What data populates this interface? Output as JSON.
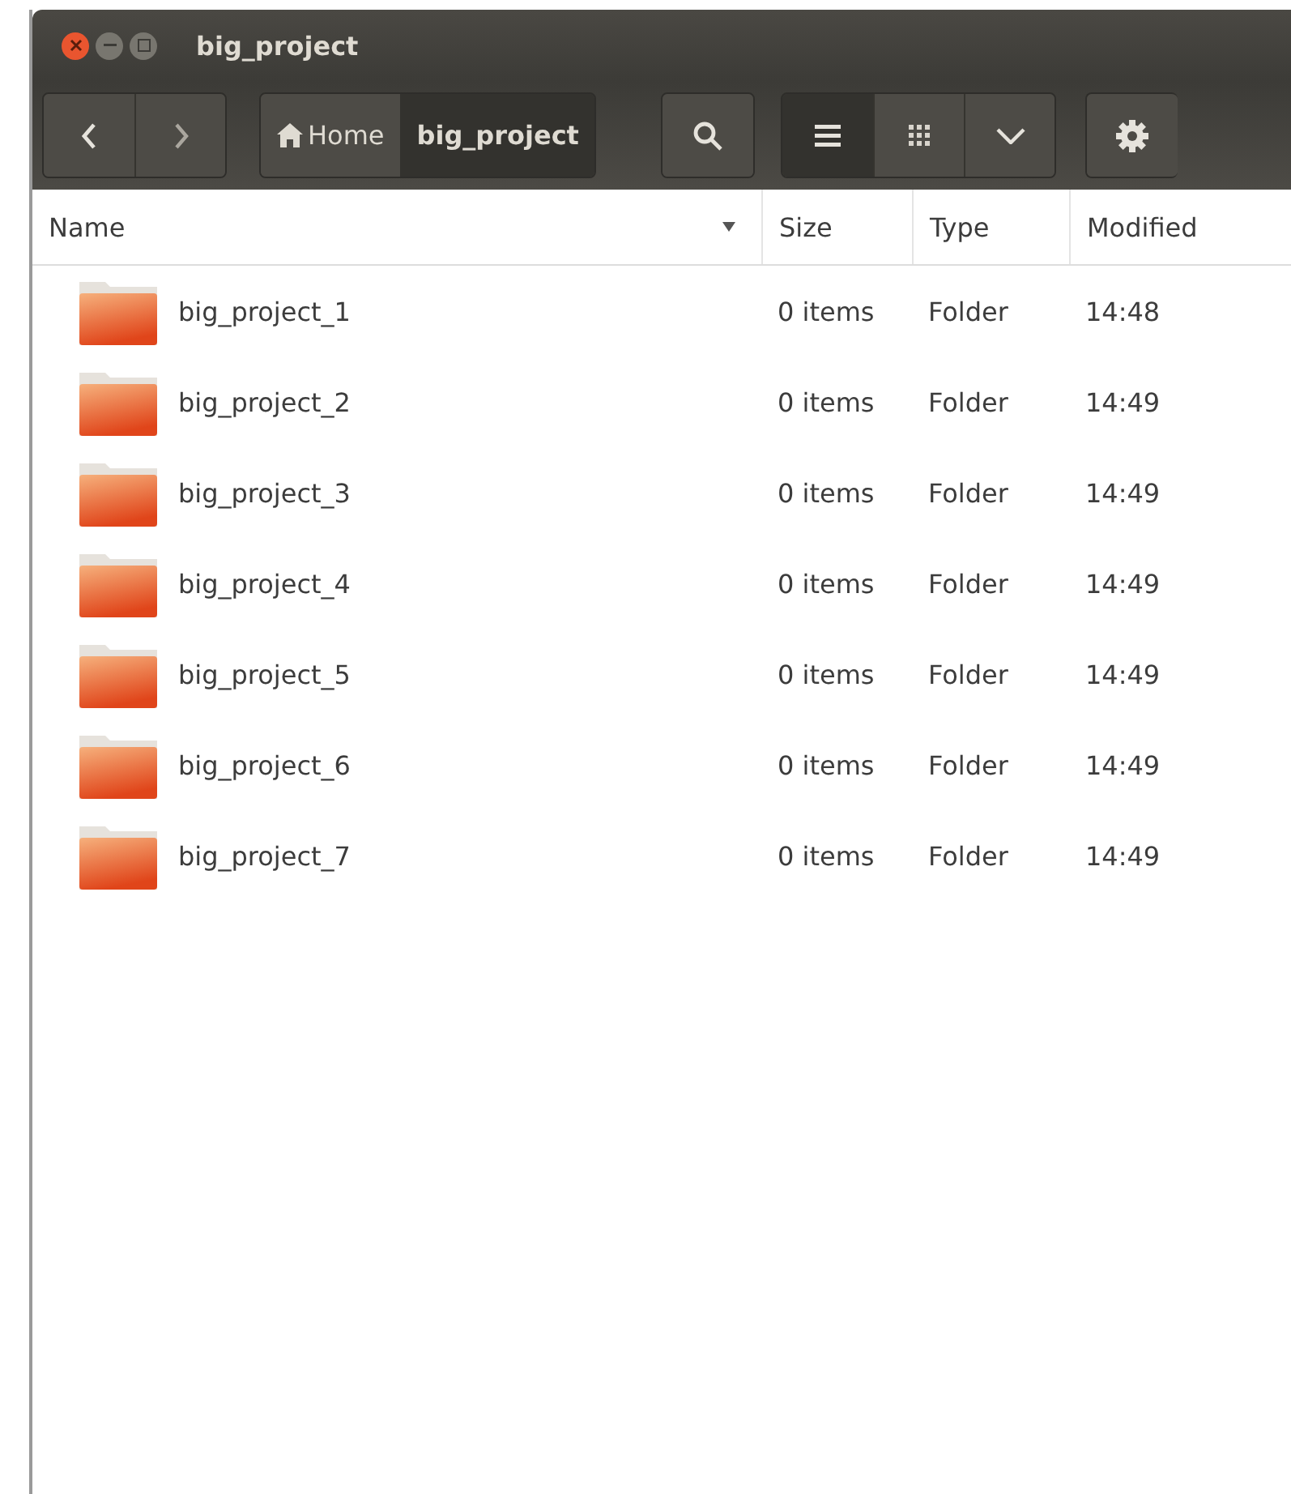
{
  "window": {
    "title": "big_project"
  },
  "breadcrumbs": [
    {
      "label": "Home",
      "kind": "home",
      "selected": false
    },
    {
      "label": "big_project",
      "kind": "folder",
      "selected": true
    }
  ],
  "view_buttons": [
    {
      "kind": "list",
      "selected": true
    },
    {
      "kind": "grid",
      "selected": false
    },
    {
      "kind": "menu",
      "selected": false
    }
  ],
  "table": {
    "columns": [
      {
        "label": "Name",
        "sorted": true
      },
      {
        "label": "Size",
        "sorted": false
      },
      {
        "label": "Type",
        "sorted": false
      },
      {
        "label": "Modified",
        "sorted": false
      }
    ],
    "rows": [
      {
        "name": "big_project_1",
        "size": "0 items",
        "type": "Folder",
        "modified": "14:48"
      },
      {
        "name": "big_project_2",
        "size": "0 items",
        "type": "Folder",
        "modified": "14:49"
      },
      {
        "name": "big_project_3",
        "size": "0 items",
        "type": "Folder",
        "modified": "14:49"
      },
      {
        "name": "big_project_4",
        "size": "0 items",
        "type": "Folder",
        "modified": "14:49"
      },
      {
        "name": "big_project_5",
        "size": "0 items",
        "type": "Folder",
        "modified": "14:49"
      },
      {
        "name": "big_project_6",
        "size": "0 items",
        "type": "Folder",
        "modified": "14:49"
      },
      {
        "name": "big_project_7",
        "size": "0 items",
        "type": "Folder",
        "modified": "14:49"
      }
    ]
  }
}
